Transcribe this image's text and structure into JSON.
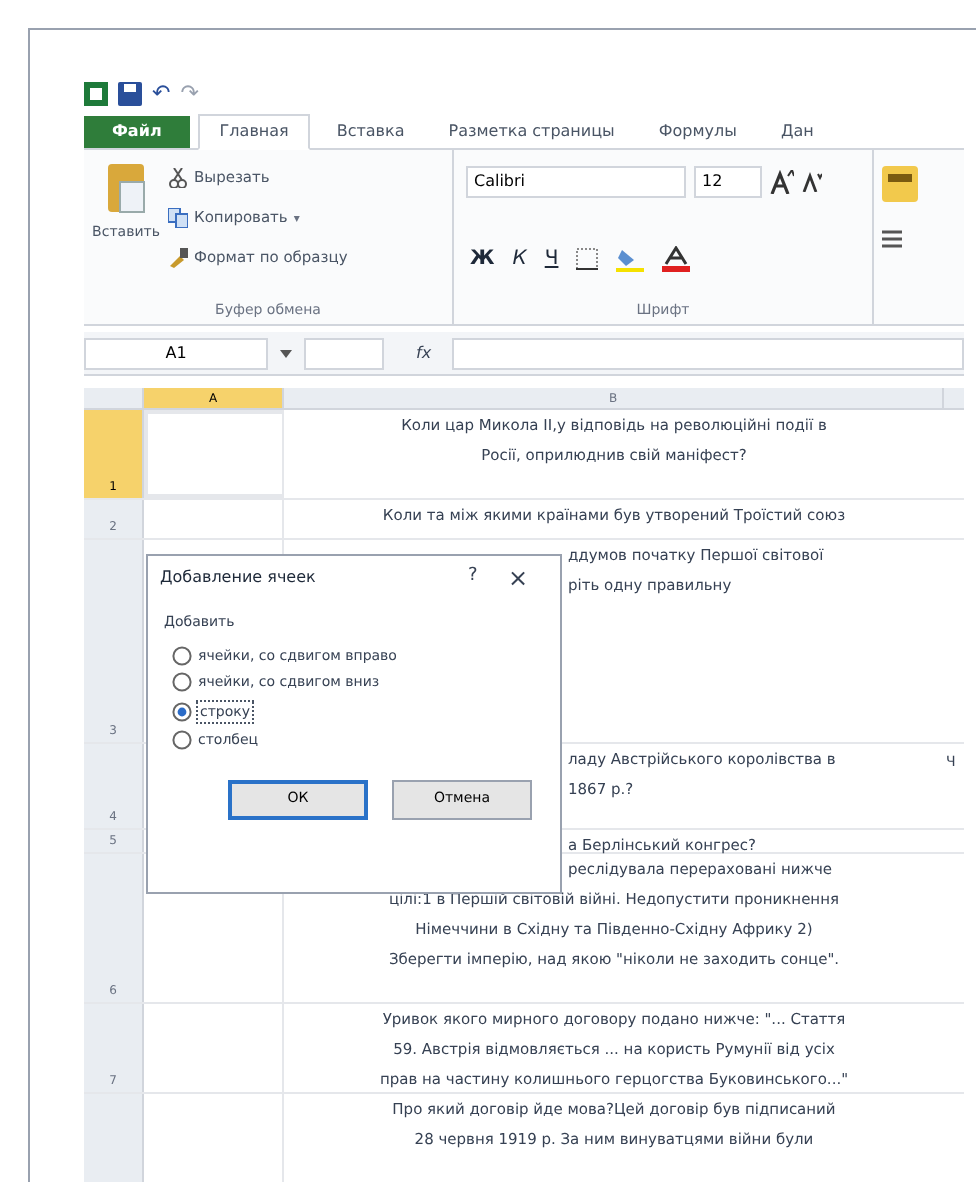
{
  "quick_access": {
    "undo": "↶",
    "redo": "↷"
  },
  "tabs": [
    {
      "label": "Файл",
      "kind": "file",
      "selected": false
    },
    {
      "label": "Главная",
      "kind": "tab",
      "selected": true
    },
    {
      "label": "Вставка",
      "kind": "tab",
      "selected": false
    },
    {
      "label": "Разметка страницы",
      "kind": "tab",
      "selected": false
    },
    {
      "label": "Формулы",
      "kind": "tab",
      "selected": false
    },
    {
      "label": "Дан",
      "kind": "tab",
      "selected": false
    }
  ],
  "clipboard": {
    "paste": "Вставить",
    "cut": "Вырезать",
    "copy": "Копировать",
    "copy_caret": "▾",
    "format_painter": "Формат по образцу",
    "group_label": "Буфер обмена"
  },
  "font": {
    "name": "Calibri",
    "size": "12",
    "bold": "Ж",
    "italic": "К",
    "underline": "Ч",
    "group_label": "Шрифт"
  },
  "formula_bar": {
    "name_box": "A1",
    "fx": "fx"
  },
  "columns": [
    {
      "label": "A",
      "selected": true
    },
    {
      "label": "B",
      "selected": false
    }
  ],
  "rows": [
    {
      "number": "1",
      "selected": true,
      "lines": [
        "Коли цар Микола ІІ,у відповідь на революційні події в",
        "Росії, оприлюднив свій маніфест?"
      ]
    },
    {
      "number": "2",
      "selected": false,
      "lines": [
        "Коли та між якими країнами був утворений Троїстий союз"
      ]
    },
    {
      "number": "3",
      "selected": false,
      "covered_lines": [
        "ддумов початку Першої світової",
        "ріть одну правильну"
      ]
    },
    {
      "number": "4",
      "selected": false,
      "covered_lines": [
        "ладу Австрійського королівства в",
        "1867 р.?"
      ],
      "column_c": "Ч"
    },
    {
      "number": "5",
      "selected": false,
      "covered_lines": [
        "а Берлінський конгрес?"
      ]
    },
    {
      "number": "6",
      "selected": false,
      "covered_lines": [
        "реслідувала перераховані нижче"
      ],
      "lines": [
        "цілі:1 в Першій світовій війні. Недопустити проникнення",
        "Німеччини в Східну та Південно-Східну Африку 2)",
        "Зберегти імперію, над якою \"ніколи не заходить сонце\"."
      ]
    },
    {
      "number": "7",
      "selected": false,
      "lines": [
        "Уривок якого мирного договору подано нижче: \"... Стаття",
        "59. Австрія відмовляється ... на користь Румунії від усіх",
        "прав на частину колишнього герцогства Буковинського...\""
      ]
    },
    {
      "selected": false,
      "lines": [
        "Про який договір йде мова?Цей договір був підписаний",
        "28 червня 1919 р. За ним винуватцями війни були"
      ]
    }
  ],
  "dialog": {
    "title": "Добавление ячеек",
    "help": "?",
    "close": "×",
    "group_label": "Добавить",
    "options": [
      {
        "label": "ячейки, со сдвигом вправо",
        "selected": false
      },
      {
        "label": "ячейки, со сдвигом вниз",
        "selected": false
      },
      {
        "label": "строку",
        "selected": true
      },
      {
        "label": "столбец",
        "selected": false
      }
    ],
    "ok": "ОК",
    "cancel": "Отмена"
  }
}
